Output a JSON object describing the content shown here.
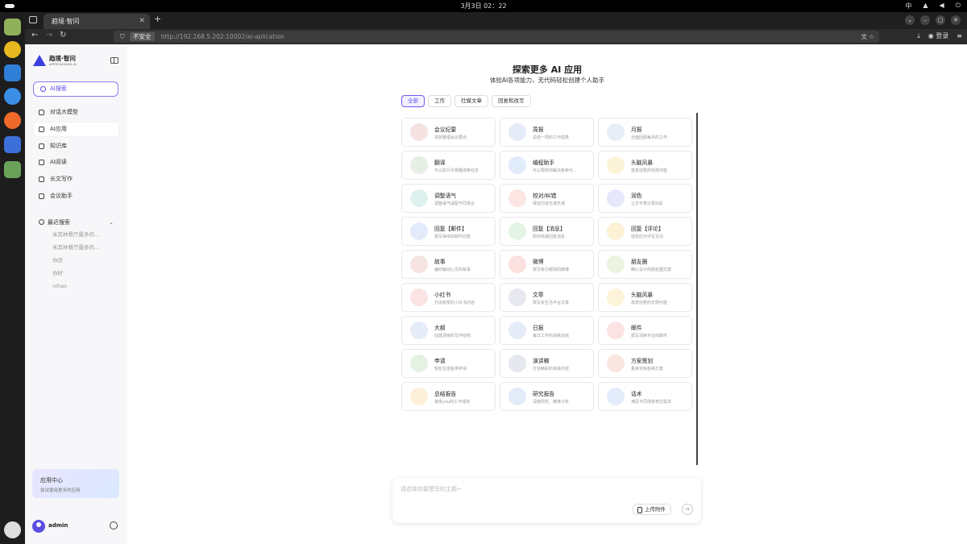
{
  "system": {
    "clock": "3月3日 02：22",
    "tray": [
      "中",
      "▲",
      "◀",
      "⏻"
    ]
  },
  "browser": {
    "tab_title": "趋境·智问",
    "url_insecure_label": "不安全",
    "url": "http://192.168.5.202:10002/ai-aplication",
    "login_label": "登录"
  },
  "sidebar": {
    "logo_cn": "趋境·智问",
    "logo_en": "APPROACHING.AI",
    "search_label": "AI搜索",
    "menu": [
      {
        "label": "对话大模型",
        "icon": "chat-icon"
      },
      {
        "label": "AI应用",
        "icon": "grid-icon",
        "active": true
      },
      {
        "label": "知识库",
        "icon": "book-icon"
      },
      {
        "label": "AI阅读",
        "icon": "reader-icon"
      },
      {
        "label": "长文写作",
        "icon": "write-icon"
      },
      {
        "label": "会议助手",
        "icon": "meeting-icon"
      }
    ],
    "recent_title": "最近搜索",
    "recent": [
      "米其林餐厅最多的...",
      "米其林餐厅最多的...",
      "你还",
      "你好",
      "nihao"
    ],
    "promo_title": "应用中心",
    "promo_sub": "尝试使用更多的应用",
    "username": "admin"
  },
  "main": {
    "title": "探索更多 AI 应用",
    "subtitle": "体验AI各项能力，无代码轻松创建个人助手",
    "filters": [
      "全部",
      "工作",
      "社媒文章",
      "回复和改写"
    ],
    "active_filter": 0,
    "apps": [
      {
        "name": "会议纪要",
        "desc": "高效整理会议要点",
        "color": "#f4e3e0"
      },
      {
        "name": "周报",
        "desc": "总结一周的工作成果",
        "color": "#e5ecf8"
      },
      {
        "name": "月报",
        "desc": "全面回顾每月的工作",
        "color": "#e8eef8"
      },
      {
        "name": "翻译",
        "desc": "可以执行中英翻译等任务",
        "color": "#e7efe4"
      },
      {
        "name": "编程助手",
        "desc": "可以帮助你解决各种代...",
        "color": "#e1ecfb"
      },
      {
        "name": "头脑风暴",
        "desc": "激发创意的无限可能",
        "color": "#fdf3d8"
      },
      {
        "name": "调整语气",
        "desc": "调整语气适配不同场合",
        "color": "#dff1ee"
      },
      {
        "name": "校对/纠错",
        "desc": "保证内容无误无误",
        "color": "#fbe6e3"
      },
      {
        "name": "润色",
        "desc": "让文字表达更出彩",
        "color": "#e5e8fb"
      },
      {
        "name": "回复【邮件】",
        "desc": "撰写得体的邮件回复",
        "color": "#e3ebfb"
      },
      {
        "name": "回复【消息】",
        "desc": "助你快速回复消息",
        "color": "#e3f4e5"
      },
      {
        "name": "回复【评论】",
        "desc": "轻松应对评论互动",
        "color": "#fdf1d6"
      },
      {
        "name": "故事",
        "desc": "编织触动心灵的故事",
        "color": "#f6e4e0"
      },
      {
        "name": "微博",
        "desc": "撰写吸引眼球的微博",
        "color": "#fbe1df"
      },
      {
        "name": "朋友圈",
        "desc": "精心设计的朋友圈文案",
        "color": "#eaf4e0"
      },
      {
        "name": "小红书",
        "desc": "打造获赞的小红书内容",
        "color": "#fbe3e3"
      },
      {
        "name": "文章",
        "desc": "撰写有生活平台文章",
        "color": "#e8e9f0"
      },
      {
        "name": "头脑风暴",
        "desc": "激发创意的无限可能",
        "color": "#fdf3d8"
      },
      {
        "name": "大纲",
        "desc": "创建清晰的写作结构",
        "color": "#e5ecf8"
      },
      {
        "name": "日报",
        "desc": "每日工作的清晰总结",
        "color": "#e5ecf8"
      },
      {
        "name": "邮件",
        "desc": "撰写清晰专业的邮件",
        "color": "#fbe4e3"
      },
      {
        "name": "申请",
        "desc": "轻松生成各类申请",
        "color": "#e4f2e4"
      },
      {
        "name": "演讲稿",
        "desc": "打造精彩的演讲内容",
        "color": "#e6e8ef"
      },
      {
        "name": "方案策划",
        "desc": "量身定制各种方案",
        "color": "#f8e6df"
      },
      {
        "name": "总结报告",
        "desc": "凝练you的工作成效",
        "color": "#fdf0d8"
      },
      {
        "name": "研究报告",
        "desc": "深度研究、精准分析",
        "color": "#e3ebf8"
      },
      {
        "name": "话术",
        "desc": "满足不同场景表达需求",
        "color": "#e3ecfb"
      }
    ],
    "input_placeholder": "请选择你要撰写的主题~",
    "upload_label": "上传附件",
    "send_label": "➜"
  }
}
